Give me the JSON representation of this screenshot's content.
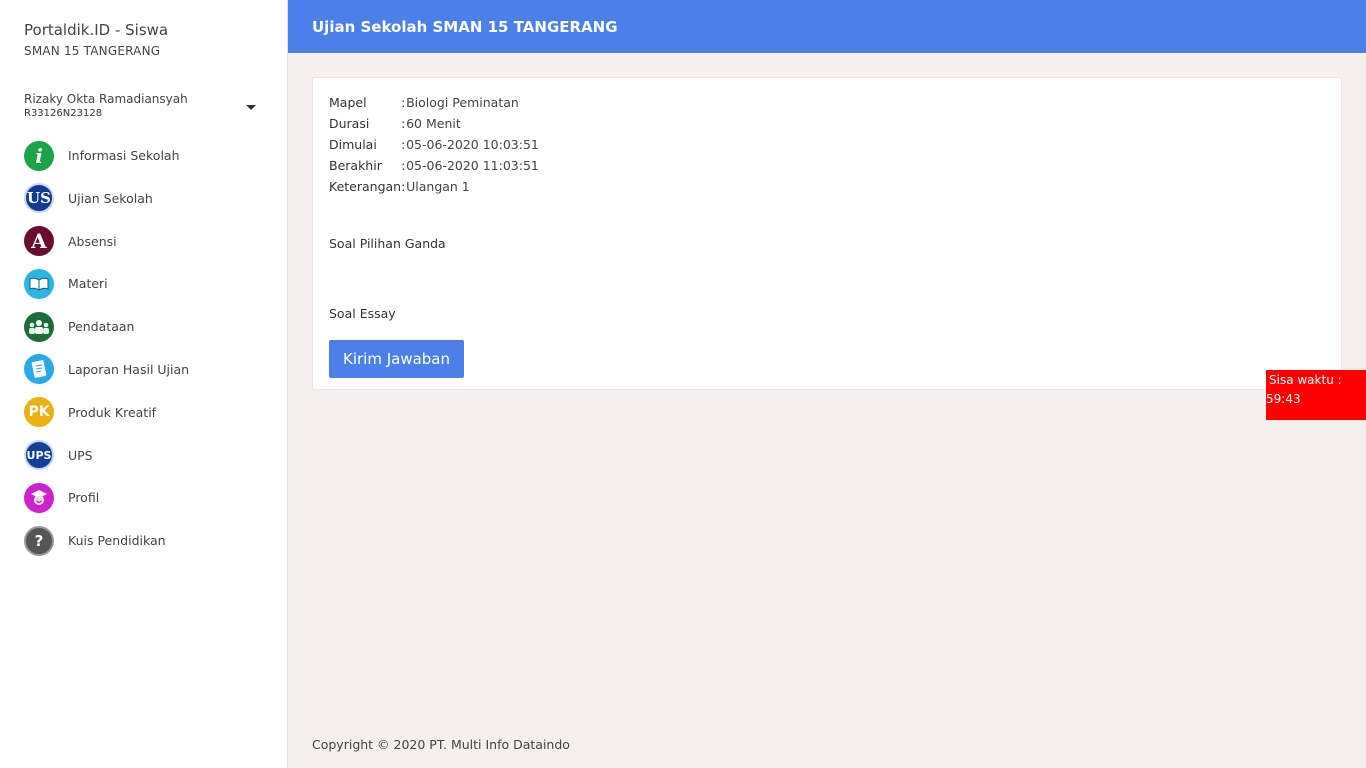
{
  "brand": {
    "title": "Portaldik.ID - Siswa",
    "school": "SMAN 15 TANGERANG"
  },
  "user": {
    "name": "Rizaky Okta Ramadiansyah",
    "id": "R33126N23128"
  },
  "menu": [
    {
      "label": "Informasi Sekolah",
      "icon": "info-icon",
      "glyph": "i",
      "color": "#1aa34a"
    },
    {
      "label": "Ujian Sekolah",
      "icon": "us-icon",
      "glyph": "US",
      "color": "#123a8f"
    },
    {
      "label": "Absensi",
      "icon": "absensi-icon",
      "glyph": "A",
      "color": "#6a0c30"
    },
    {
      "label": "Materi",
      "icon": "book-icon",
      "glyph": "📖",
      "color": "#29b7e0"
    },
    {
      "label": "Pendataan",
      "icon": "people-icon",
      "glyph": "👥",
      "color": "#1f6b3a"
    },
    {
      "label": "Laporan Hasil Ujian",
      "icon": "report-icon",
      "glyph": "✎",
      "color": "#2ba8e6"
    },
    {
      "label": "Produk Kreatif",
      "icon": "pk-icon",
      "glyph": "PK",
      "color": "#e8b211"
    },
    {
      "label": "UPS",
      "icon": "ups-icon",
      "glyph": "UPS",
      "color": "#153f95"
    },
    {
      "label": "Profil",
      "icon": "profile-icon",
      "glyph": "🎓",
      "color": "#cc22cc"
    },
    {
      "label": "Kuis Pendidikan",
      "icon": "quiz-icon",
      "glyph": "?",
      "color": "#555555"
    }
  ],
  "header": {
    "title": "Ujian Sekolah SMAN 15 TANGERANG"
  },
  "exam": {
    "rows": [
      {
        "key": "Mapel",
        "value": "Biologi Peminatan"
      },
      {
        "key": "Durasi",
        "value": "60 Menit"
      },
      {
        "key": "Dimulai",
        "value": "05-06-2020 10:03:51"
      },
      {
        "key": "Berakhir",
        "value": "05-06-2020 11:03:51"
      },
      {
        "key": "Keterangan",
        "value": "Ulangan 1"
      }
    ],
    "section_pg": "Soal Pilihan Ganda",
    "section_essay": "Soal Essay",
    "submit_label": "Kirim Jawaban"
  },
  "timer": {
    "label": "Sisa waktu :",
    "value": "59:43"
  },
  "footer": {
    "text": "Copyright © 2020 PT. Multi Info Dataindo"
  },
  "colors": {
    "accent": "#4d7fe8",
    "timer": "#ff0000",
    "background": "#f7eeee"
  }
}
